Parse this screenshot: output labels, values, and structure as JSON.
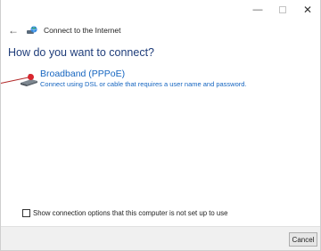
{
  "titlebar": {
    "minimize_glyph": "—",
    "close_glyph": "✕"
  },
  "header": {
    "back_glyph": "←",
    "title": "Connect to the Internet"
  },
  "main": {
    "heading": "How do you want to connect?",
    "option": {
      "title": "Broadband (PPPoE)",
      "description": "Connect using DSL or cable that requires a user name and password.",
      "icon": "broadband-modem-icon"
    },
    "checkbox": {
      "label": "Show connection options that this computer is not set up to use",
      "checked": false
    }
  },
  "footer": {
    "cancel_label": "Cancel"
  },
  "colors": {
    "link": "#1565c0",
    "heading": "#1f3d7a",
    "annotation": "#d9262e"
  }
}
